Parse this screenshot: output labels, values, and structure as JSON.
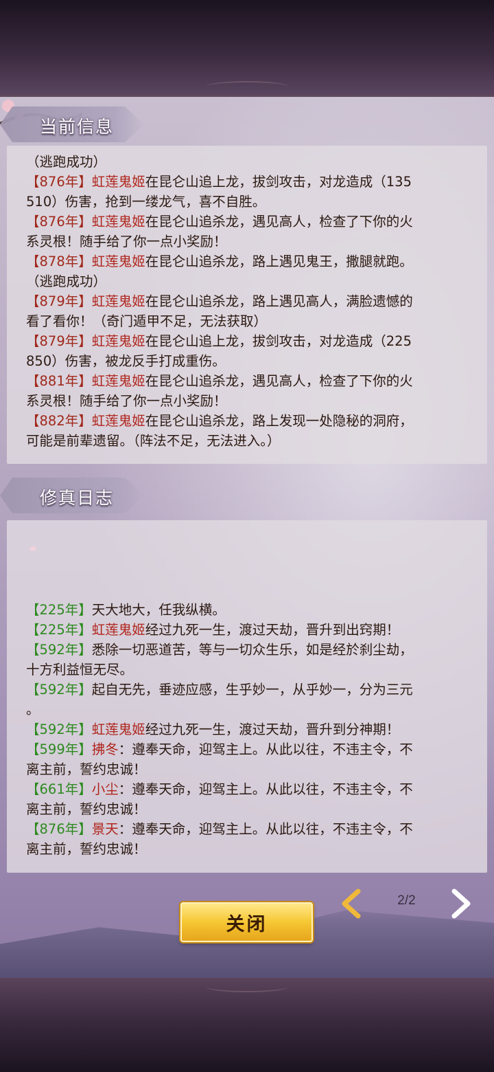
{
  "current_info": {
    "title": "当前信息",
    "lines": [
      [
        {
          "t": "（逃跑成功）",
          "c": ""
        }
      ],
      [
        {
          "t": "【876年】",
          "c": "yr-red"
        },
        {
          "t": "虹莲鬼姬",
          "c": "nm"
        },
        {
          "t": "在昆仑山追上龙，拔剑攻击，对龙造成（135",
          "c": ""
        }
      ],
      [
        {
          "t": "510）伤害，抢到一缕龙气，喜不自胜。",
          "c": ""
        }
      ],
      [
        {
          "t": "【876年】",
          "c": "yr-red"
        },
        {
          "t": "虹莲鬼姬",
          "c": "nm"
        },
        {
          "t": "在昆仑山追杀龙，遇见高人，检查了下你的火",
          "c": ""
        }
      ],
      [
        {
          "t": "系灵根！随手给了你一点小奖励！",
          "c": ""
        }
      ],
      [
        {
          "t": "【878年】",
          "c": "yr-red"
        },
        {
          "t": "虹莲鬼姬",
          "c": "nm"
        },
        {
          "t": "在昆仑山追杀龙，路上遇见鬼王，撒腿就跑。",
          "c": ""
        }
      ],
      [
        {
          "t": "（逃跑成功）",
          "c": ""
        }
      ],
      [
        {
          "t": "【879年】",
          "c": "yr-red"
        },
        {
          "t": "虹莲鬼姬",
          "c": "nm"
        },
        {
          "t": "在昆仑山追杀龙，路上遇见高人，满脸遗憾的",
          "c": ""
        }
      ],
      [
        {
          "t": "看了看你！（奇门遁甲不足，无法获取）",
          "c": ""
        }
      ],
      [
        {
          "t": "【879年】",
          "c": "yr-red"
        },
        {
          "t": "虹莲鬼姬",
          "c": "nm"
        },
        {
          "t": "在昆仑山追上龙，拔剑攻击，对龙造成（225",
          "c": ""
        }
      ],
      [
        {
          "t": "850）伤害，被龙反手打成重伤。",
          "c": ""
        }
      ],
      [
        {
          "t": "【881年】",
          "c": "yr-red"
        },
        {
          "t": "虹莲鬼姬",
          "c": "nm"
        },
        {
          "t": "在昆仑山追杀龙，遇见高人，检查了下你的火",
          "c": ""
        }
      ],
      [
        {
          "t": "系灵根！随手给了你一点小奖励！",
          "c": ""
        }
      ],
      [
        {
          "t": "【882年】",
          "c": "yr-red"
        },
        {
          "t": "虹莲鬼姬",
          "c": "nm"
        },
        {
          "t": "在昆仑山追杀龙，路上发现一处隐秘的洞府，",
          "c": ""
        }
      ],
      [
        {
          "t": "可能是前辈遗留。（阵法不足，无法进入。）",
          "c": ""
        }
      ]
    ]
  },
  "cultivation_log": {
    "title": "修真日志",
    "lines": [
      [
        {
          "t": "【225年】",
          "c": "yr-green"
        },
        {
          "t": "天大地大，任我纵横。",
          "c": ""
        }
      ],
      [
        {
          "t": "【225年】",
          "c": "yr-green"
        },
        {
          "t": "虹莲鬼姬",
          "c": "nm"
        },
        {
          "t": "经过九死一生，渡过天劫，晋升到出窍期！",
          "c": ""
        }
      ],
      [
        {
          "t": "【592年】",
          "c": "yr-green"
        },
        {
          "t": "悉除一切恶道苦，等与一切众生乐，如是经於刹尘劫，",
          "c": ""
        }
      ],
      [
        {
          "t": "十方利益恒无尽。",
          "c": ""
        }
      ],
      [
        {
          "t": "【592年】",
          "c": "yr-green"
        },
        {
          "t": "起自无先，垂迹应感，生乎妙一，从乎妙一，分为三元",
          "c": ""
        }
      ],
      [
        {
          "t": "。",
          "c": ""
        }
      ],
      [
        {
          "t": "【592年】",
          "c": "yr-green"
        },
        {
          "t": "虹莲鬼姬",
          "c": "nm"
        },
        {
          "t": "经过九死一生，渡过天劫，晋升到分神期！",
          "c": ""
        }
      ],
      [
        {
          "t": "【599年】",
          "c": "yr-green"
        },
        {
          "t": "拂冬",
          "c": "nm"
        },
        {
          "t": "：遵奉天命，迎驾主上。从此以往，不违主令，不",
          "c": ""
        }
      ],
      [
        {
          "t": "离主前，誓约忠诚！",
          "c": ""
        }
      ],
      [
        {
          "t": "【661年】",
          "c": "yr-green"
        },
        {
          "t": "小尘",
          "c": "nm"
        },
        {
          "t": "：遵奉天命，迎驾主上。从此以往，不违主令，不",
          "c": ""
        }
      ],
      [
        {
          "t": "离主前，誓约忠诚！",
          "c": ""
        }
      ],
      [
        {
          "t": "【876年】",
          "c": "yr-green"
        },
        {
          "t": "景天",
          "c": "nm"
        },
        {
          "t": "：遵奉天命，迎驾主上。从此以往，不违主令，不",
          "c": ""
        }
      ],
      [
        {
          "t": "离主前，誓约忠诚！",
          "c": ""
        }
      ]
    ]
  },
  "buttons": {
    "close": "关闭"
  },
  "pagination": {
    "indicator": "2/2",
    "prev_icon": "chevron-left-icon",
    "next_icon": "chevron-right-icon"
  },
  "colors": {
    "year_red": "#a0281a",
    "year_green": "#2d8a20",
    "name": "#b0261d",
    "button_gold": "#f6c733"
  }
}
